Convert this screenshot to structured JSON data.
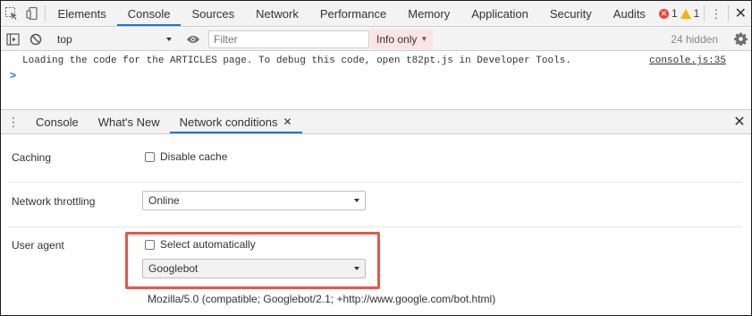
{
  "topbar": {
    "tabs": [
      "Elements",
      "Console",
      "Sources",
      "Network",
      "Performance",
      "Memory",
      "Application",
      "Security",
      "Audits"
    ],
    "active_tab": "Console",
    "error_count": "1",
    "warning_count": "1"
  },
  "console_toolbar": {
    "context": "top",
    "filter_placeholder": "Filter",
    "level": "Info only",
    "hidden": "24 hidden"
  },
  "console": {
    "message": "Loading the code for the ARTICLES page. To debug this code, open t82pt.js in Developer Tools.",
    "source": "console.js:35",
    "prompt": ">"
  },
  "drawer": {
    "tabs": [
      "Console",
      "What's New",
      "Network conditions"
    ],
    "active_tab": "Network conditions"
  },
  "network_conditions": {
    "caching_label": "Caching",
    "disable_cache_label": "Disable cache",
    "throttling_label": "Network throttling",
    "throttling_value": "Online",
    "user_agent_label": "User agent",
    "select_automatically_label": "Select automatically",
    "user_agent_value": "Googlebot",
    "user_agent_string": "Mozilla/5.0 (compatible; Googlebot/2.1; +http://www.google.com/bot.html)"
  },
  "colors": {
    "accent": "#1a73e8",
    "highlight": "#e8564a",
    "error": "#e8453c",
    "warning": "#f4b400"
  }
}
